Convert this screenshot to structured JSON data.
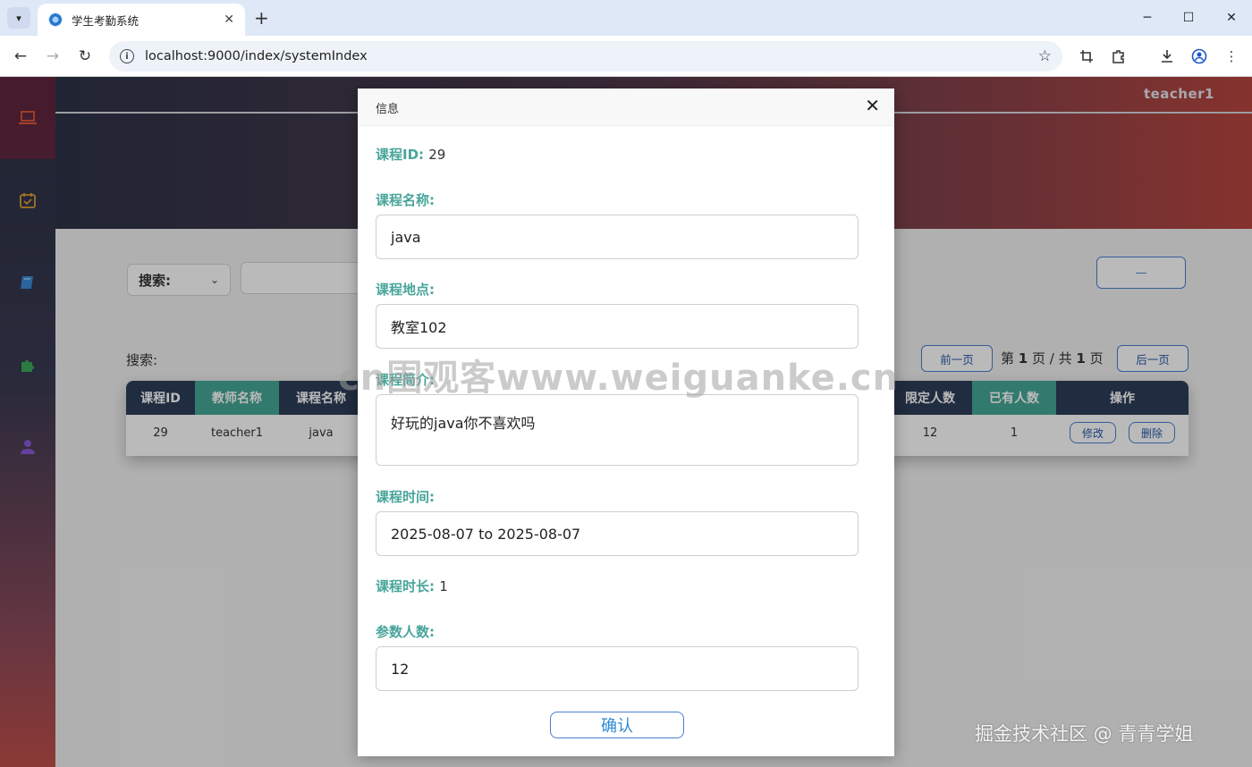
{
  "browser": {
    "tab_title": "学生考勤系统",
    "tab_close": "✕",
    "new_tab": "+",
    "url": "localhost:9000/index/systemIndex",
    "win_min": "─",
    "win_max": "☐",
    "win_close": "✕"
  },
  "header": {
    "user": "teacher1"
  },
  "sidebar": {
    "items": [
      {
        "icon": "laptop-icon",
        "color": "#e05a3a"
      },
      {
        "icon": "calendar-check-icon",
        "color": "#e0a030"
      },
      {
        "icon": "book-icon",
        "color": "#3a8ad8"
      },
      {
        "icon": "puzzle-icon",
        "color": "#3aa85a"
      },
      {
        "icon": "user-icon",
        "color": "#8a5ad8"
      }
    ]
  },
  "search": {
    "select_label": "搜索:",
    "label": "搜索:",
    "right_button": "—"
  },
  "pager": {
    "prev": "前一页",
    "next": "后一页",
    "pre": "第",
    "current": "1",
    "mid": "页 / 共",
    "total": "1",
    "post": "页"
  },
  "table": {
    "headers": [
      "课程ID",
      "教师名称",
      "课程名称",
      "限定人数",
      "已有人数",
      "操作"
    ],
    "row": {
      "id": "29",
      "teacher": "teacher1",
      "name": "java",
      "limit": "12",
      "current": "1",
      "edit": "修改",
      "delete": "删除"
    }
  },
  "dialog": {
    "title": "信息",
    "close": "✕",
    "course_id_label": "课程ID:",
    "course_id": "29",
    "name_label": "课程名称:",
    "name": "java",
    "location_label": "课程地点:",
    "location": "教室102",
    "intro_label": "课程简介:",
    "intro": "好玩的java你不喜欢吗",
    "time_label": "课程时间:",
    "time": "2025-08-07 to 2025-08-07",
    "duration_label": "课程时长:",
    "duration": "1",
    "count_label": "参数人数:",
    "count": "12",
    "confirm": "确认"
  },
  "watermark": "cn围观客www.weiguanke.cn",
  "credit": "掘金技术社区 @ 青青学姐",
  "colors": {
    "accent_green": "#47a59a",
    "header_dark": "#2d3d57",
    "button_blue": "#4a7fd0"
  }
}
